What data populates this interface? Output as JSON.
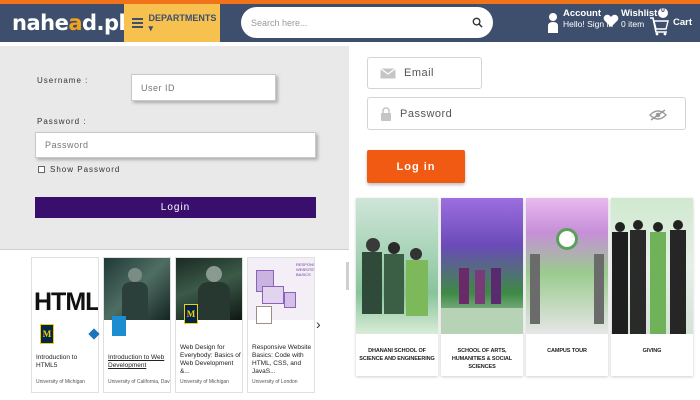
{
  "header": {
    "logo_left": "nahe",
    "logo_mid": "a",
    "logo_right": "d.pk",
    "departments_label": "DEPARTMENTS ▾",
    "search_placeholder": "Search here...",
    "account_title": "Account",
    "account_sub": "Hello! Sign in",
    "wishlist_title": "Wishlist",
    "wishlist_sub": "0 item",
    "cart_label": "Cart",
    "cart_count": "0"
  },
  "left_login": {
    "username_label": "Username :",
    "username_placeholder": "User ID",
    "password_label": "Password :",
    "password_placeholder": "Password",
    "show_password_label": "Show Password",
    "login_button": "Login"
  },
  "right_login": {
    "email_placeholder": "Email",
    "password_placeholder": "Password",
    "login_button": "Log in"
  },
  "courses": [
    {
      "title": "Introduction to HTML5",
      "org": "University of Michigan",
      "thumb_text": "HTML"
    },
    {
      "title": "Introduction to Web Development",
      "org": "University of California, Davis",
      "thumb_text": ""
    },
    {
      "title": "Web Design for Everybody: Basics of Web Development &...",
      "org": "University of Michigan",
      "thumb_text": ""
    },
    {
      "title": "Responsive Website Basics: Code with HTML, CSS, and JavaS...",
      "org": "University of London",
      "thumb_text": "RESPONSIVE WEBSITE BASICS"
    }
  ],
  "tour_cards": [
    {
      "label": "DHANANI SCHOOL OF SCIENCE AND ENGINEERING"
    },
    {
      "label": "SCHOOL OF ARTS, HUMANITIES & SOCIAL SCIENCES"
    },
    {
      "label": "CAMPUS TOUR"
    },
    {
      "label": "GIVING"
    }
  ],
  "colors": {
    "header_bg": "#3e4f6d",
    "accent_orange": "#f0731a",
    "departments_bg": "#f6c14f",
    "login_purple": "#3a0e6d",
    "login_orange": "#f05a12"
  }
}
